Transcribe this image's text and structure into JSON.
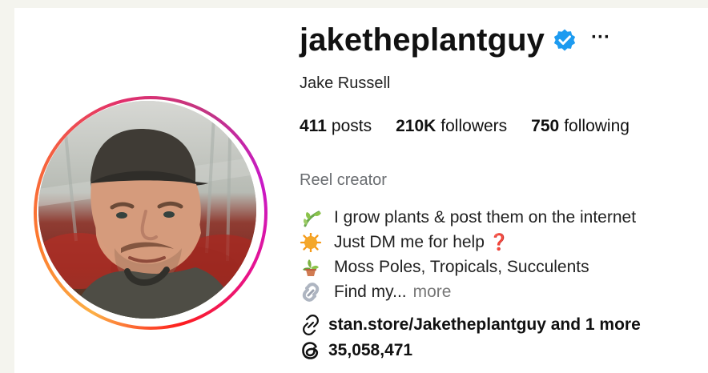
{
  "profile": {
    "username": "jaketheplantguy",
    "full_name": "Jake Russell",
    "category": "Reel creator",
    "stats": {
      "posts_count": "411",
      "posts_label": "posts",
      "followers_count": "210K",
      "followers_label": "followers",
      "following_count": "750",
      "following_label": "following"
    },
    "bio": [
      {
        "icon": "seedling-icon",
        "text": "I grow plants & post them on the internet"
      },
      {
        "icon": "sun-icon",
        "text": "Just DM me for help",
        "suffix_icon": "question-icon",
        "suffix_text": "❓"
      },
      {
        "icon": "potted-plant-icon",
        "text": "Moss Poles, Tropicals, Succulents"
      },
      {
        "icon": "link-chain-icon",
        "text": "Find my...",
        "more": "more"
      }
    ],
    "link_text": "stan.store/Jaketheplantguy and 1 more",
    "threads_count": "35,058,471"
  },
  "colors": {
    "verified": "#1d9bf0",
    "text": "#111111",
    "muted": "#6a6d71",
    "ring_start": "#fcaf45",
    "ring_end": "#c819c8"
  },
  "icons": {
    "more_options": "more-options-icon",
    "verified": "verified-badge-icon",
    "external_link": "link-icon",
    "threads": "threads-icon"
  }
}
